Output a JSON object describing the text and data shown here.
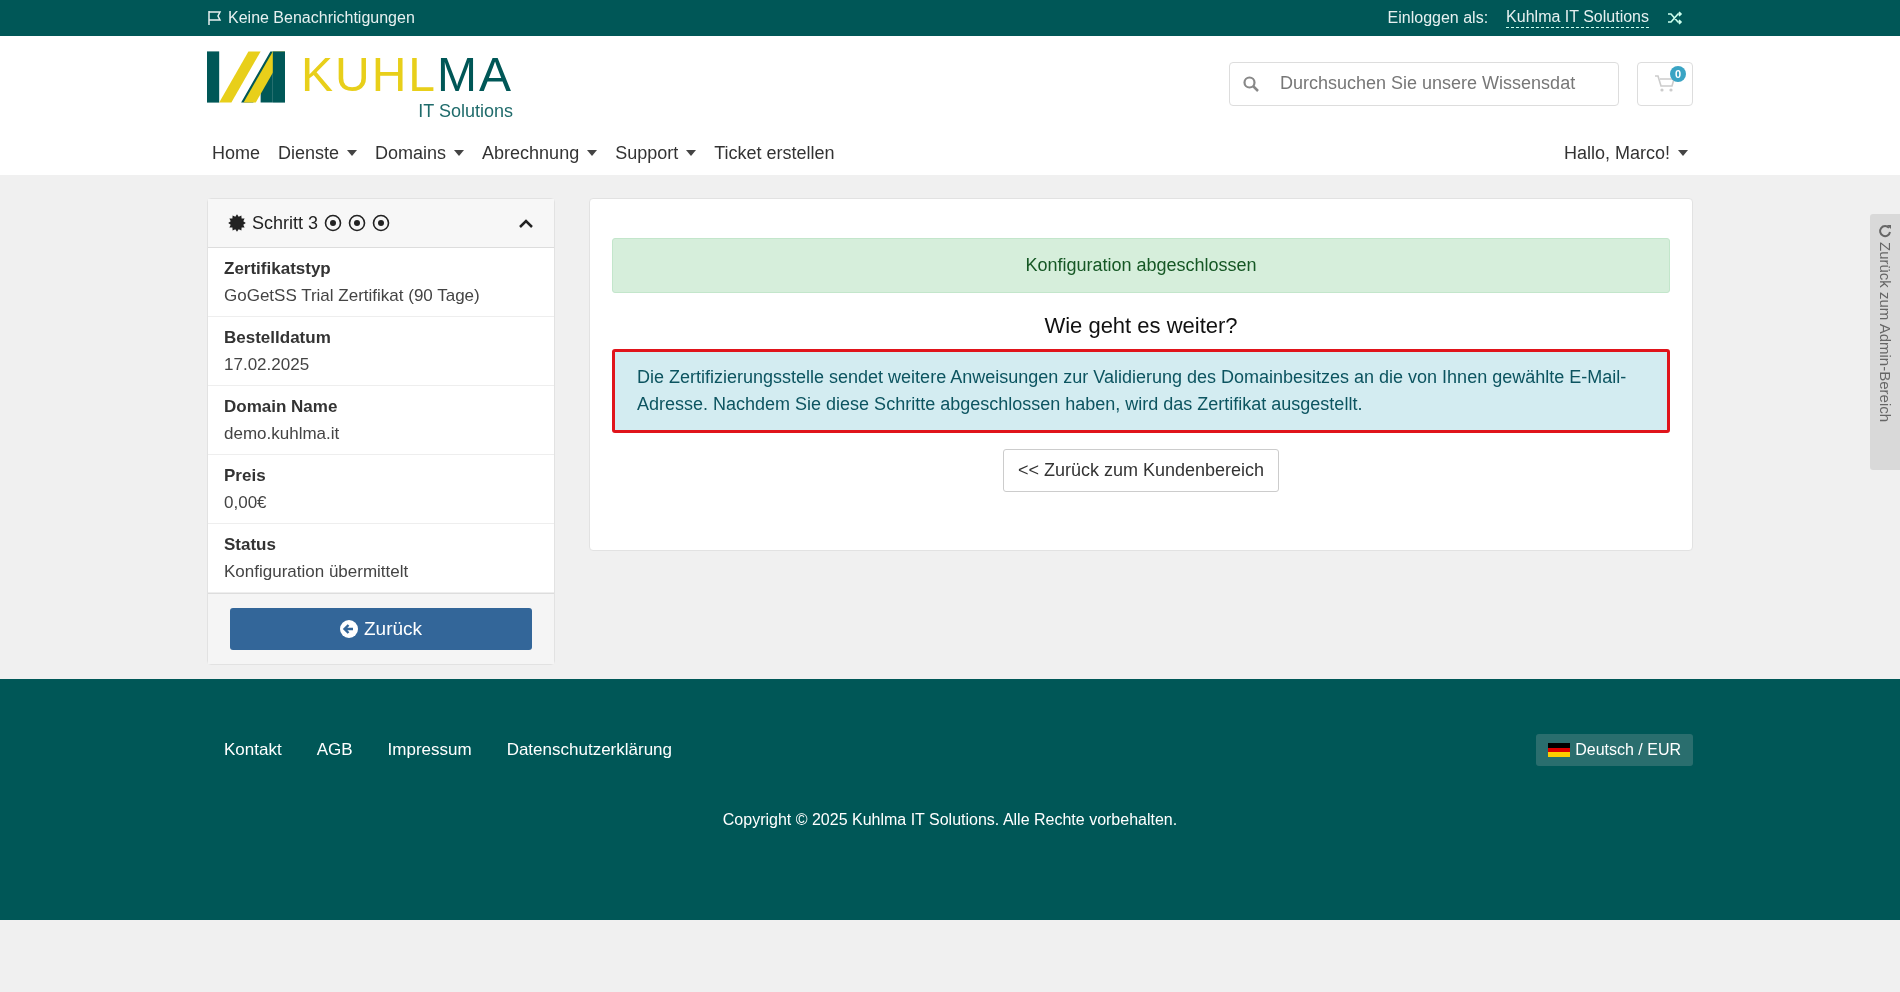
{
  "topbar": {
    "notifications": "Keine Benachrichtigungen",
    "login_label": "Einloggen als:",
    "login_name": "Kuhlma IT Solutions"
  },
  "logo": {
    "wordmark_parts": [
      "KUHL",
      "MA"
    ],
    "tagline": "IT Solutions"
  },
  "search": {
    "placeholder": "Durchsuchen Sie unsere Wissensdat"
  },
  "cart": {
    "count": "0"
  },
  "nav": [
    {
      "label": "Home",
      "dropdown": false
    },
    {
      "label": "Dienste",
      "dropdown": true
    },
    {
      "label": "Domains",
      "dropdown": true
    },
    {
      "label": "Abrechnung",
      "dropdown": true
    },
    {
      "label": "Support",
      "dropdown": true
    },
    {
      "label": "Ticket erstellen",
      "dropdown": false
    }
  ],
  "user_menu": {
    "label": "Hallo, Marco!"
  },
  "sidebar": {
    "title": "Schritt 3",
    "expanded": true,
    "fields": [
      {
        "label": "Zertifikatstyp",
        "value": "GoGetSS Trial Zertifikat (90 Tage)"
      },
      {
        "label": "Bestelldatum",
        "value": "17.02.2025"
      },
      {
        "label": "Domain Name",
        "value": "demo.kuhlma.it"
      },
      {
        "label": "Preis",
        "value": "0,00€"
      },
      {
        "label": "Status",
        "value": "Konfiguration übermittelt"
      }
    ],
    "button": "Zurück"
  },
  "main": {
    "success": "Konfiguration abgeschlossen",
    "heading": "Wie geht es weiter?",
    "info": "Die Zertifizierungsstelle sendet weitere Anweisungen zur Validierung des Domainbesitzes an die von Ihnen gewählte E-Mail-Adresse. Nachdem Sie diese Schritte abgeschlossen haben, wird das Zertifikat ausgestellt.",
    "info_highlighted": true,
    "button": "<< Zurück zum Kundenbereich"
  },
  "admin_tab": "Zurück zum Admin-Bereich",
  "footer": {
    "links": [
      "Kontakt",
      "AGB",
      "Impressum",
      "Datenschutzerklärung"
    ],
    "language": "Deutsch / EUR",
    "copyright": "Copyright © 2025 Kuhlma IT Solutions. Alle Rechte vorbehalten."
  }
}
